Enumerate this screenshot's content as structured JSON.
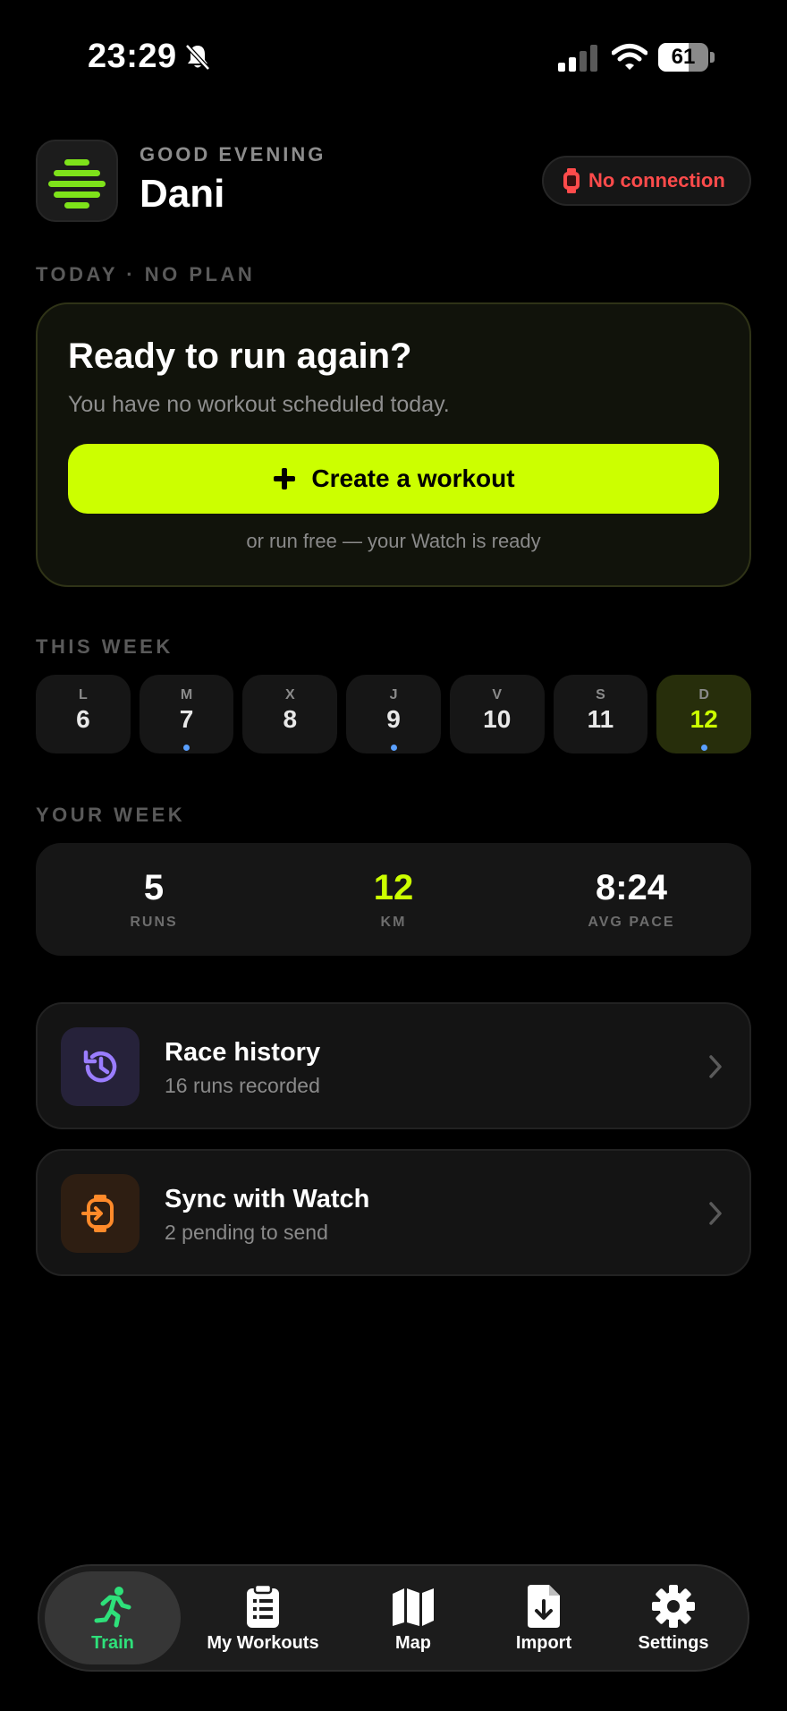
{
  "status_bar": {
    "time": "23:29",
    "battery": "61",
    "battery_level": 0.61
  },
  "header": {
    "greeting": "GOOD EVENING",
    "name": "Dani",
    "connection": "No connection"
  },
  "today": {
    "section_label": "TODAY · NO PLAN",
    "title": "Ready to run again?",
    "subtitle": "You have no workout scheduled today.",
    "button_label": "Create a workout",
    "footer": "or run free — your Watch is ready"
  },
  "this_week": {
    "section_label": "THIS WEEK",
    "days": [
      {
        "letter": "L",
        "number": "6",
        "dot": false,
        "active": false
      },
      {
        "letter": "M",
        "number": "7",
        "dot": true,
        "active": false
      },
      {
        "letter": "X",
        "number": "8",
        "dot": false,
        "active": false
      },
      {
        "letter": "J",
        "number": "9",
        "dot": true,
        "active": false
      },
      {
        "letter": "V",
        "number": "10",
        "dot": false,
        "active": false
      },
      {
        "letter": "S",
        "number": "11",
        "dot": false,
        "active": false
      },
      {
        "letter": "D",
        "number": "12",
        "dot": true,
        "active": true
      }
    ]
  },
  "your_week": {
    "section_label": "YOUR WEEK",
    "stats": [
      {
        "value": "5",
        "label": "RUNS"
      },
      {
        "value": "12",
        "label": "KM"
      },
      {
        "value": "8:24",
        "label": "AVG PACE"
      }
    ]
  },
  "cards": [
    {
      "title": "Race history",
      "subtitle": "16 runs recorded"
    },
    {
      "title": "Sync with Watch",
      "subtitle": "2 pending to send"
    }
  ],
  "tabs": [
    {
      "label": "Train",
      "icon": "runner-icon"
    },
    {
      "label": "My Workouts",
      "icon": "clipboard-icon"
    },
    {
      "label": "Map",
      "icon": "map-icon"
    },
    {
      "label": "Import",
      "icon": "import-icon"
    },
    {
      "label": "Settings",
      "icon": "gear-icon"
    }
  ],
  "colors": {
    "accent": "#ccff00",
    "error": "#ff4b4b",
    "active_tab": "#2ee07a",
    "history_icon": "#9a7dff",
    "watch_icon": "#ff8a2a",
    "dot": "#5aa0ff"
  }
}
